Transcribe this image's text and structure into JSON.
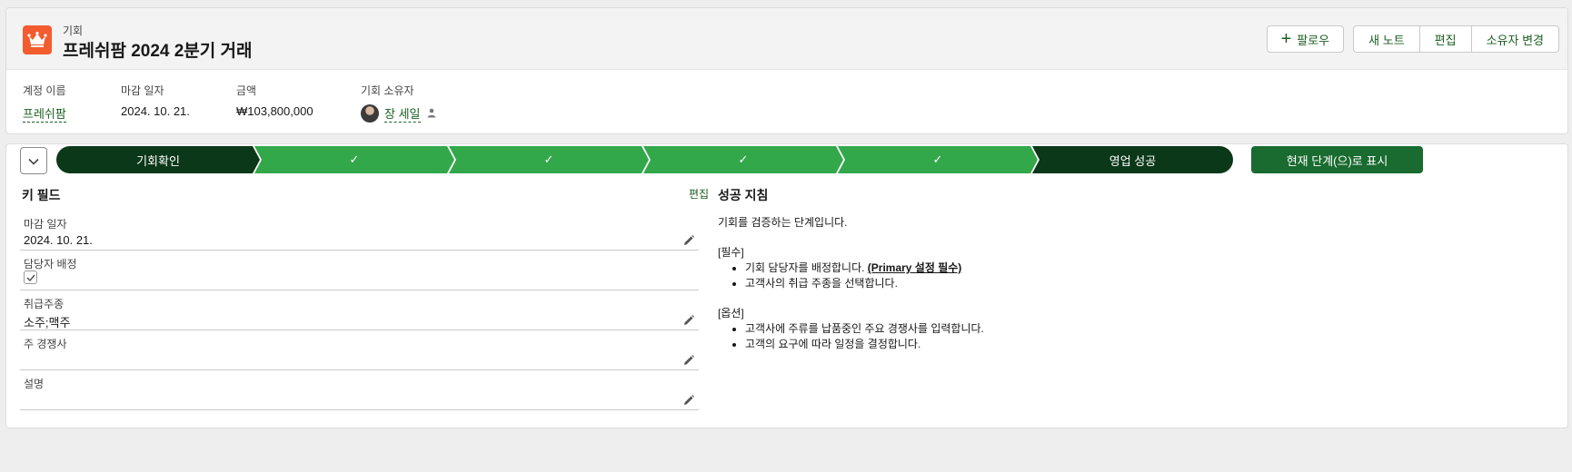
{
  "header": {
    "object_type": "기회",
    "title": "프레쉬팜 2024 2분기 거래",
    "icon": "crown-icon",
    "accent": "#f25c2e",
    "buttons": {
      "follow": "팔로우",
      "new_note": "새 노트",
      "edit": "편집",
      "change_owner": "소유자 변경"
    }
  },
  "highlights": [
    {
      "label": "계정 이름",
      "value": "프레쉬팜"
    },
    {
      "label": "마감 일자",
      "value": "2024. 10. 21."
    },
    {
      "label": "금액",
      "value": "₩103,800,000"
    },
    {
      "label": "기회 소유자",
      "value": "장 세일"
    }
  ],
  "path": {
    "steps": [
      {
        "label": "기회확인",
        "state": "current"
      },
      {
        "label": "✓",
        "state": "complete"
      },
      {
        "label": "✓",
        "state": "complete"
      },
      {
        "label": "✓",
        "state": "complete"
      },
      {
        "label": "✓",
        "state": "complete"
      },
      {
        "label": "영업 성공",
        "state": "closed"
      }
    ],
    "mark_button": "현재 단계(으)로 표시",
    "colors": {
      "dark": "#0b3818",
      "complete": "#33a84a",
      "button": "#196b2f"
    }
  },
  "key_fields": {
    "title": "키 필드",
    "edit": "편집",
    "items": [
      {
        "label": "마감 일자",
        "value": "2024. 10. 21."
      },
      {
        "label": "담당자 배정",
        "value": "",
        "checked": true
      },
      {
        "label": "취급주종",
        "value": "소주;맥주"
      },
      {
        "label": "주 경쟁사",
        "value": ""
      },
      {
        "label": "설명",
        "value": ""
      }
    ]
  },
  "guidance": {
    "title": "성공 지침",
    "intro": "기회를 검증하는 단계입니다.",
    "required_title": "[필수]",
    "required_item1_text": "기회 담당자를 배정합니다. ",
    "required_item1_bold": "(Primary 설정 필수)",
    "required_item2": "고객사의 취급 주종을 선택합니다.",
    "optional_title": "[옵션]",
    "optional_item1": "고객사에 주류를 납품중인 주요 경쟁사를 입력합니다.",
    "optional_item2": "고객의 요구에 따라 일정을 결정합니다."
  }
}
